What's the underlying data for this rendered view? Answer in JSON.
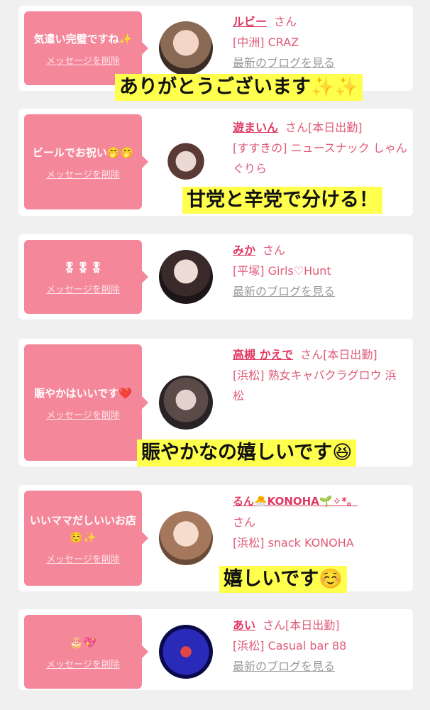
{
  "delete_label": "メッセージを削除",
  "san": "さん",
  "blog_link": "最新のブログを見る",
  "cards": [
    {
      "message": "気遣い完璧ですね✨",
      "name": "ルビー",
      "status": "",
      "shop": "[中洲] CRAZ",
      "blog": "最新のブログを見る",
      "caption": "ありがとうございます✨✨"
    },
    {
      "message": "ビールでお祝い🤭🤭",
      "name": "遊まいん",
      "status": "[本日出勤]",
      "shop": "[すすきの] ニュースナック しゃんぐりら",
      "caption": "甘党と辛党で分ける！"
    },
    {
      "message": "🎖🎖🎖",
      "name": "みか",
      "status": "",
      "shop": "[平塚] Girls♡Hunt",
      "blog": "最新のブログを見る"
    },
    {
      "message": "賑やかはいいです❤️",
      "name": "高槻 かえで",
      "status": "[本日出勤]",
      "shop": "[浜松] 熟女キャバクラグロウ 浜松",
      "caption": "賑やかなの嬉しいです😆"
    },
    {
      "message": "いいママだしいいお店☺️✨",
      "name": "るん🐣KONOHA🌱✧*。",
      "status": "",
      "shop": "[浜松] snack KONOHA",
      "caption": "嬉しいです☺️"
    },
    {
      "message": "🎂💖",
      "name": "あい",
      "status": "[本日出勤]",
      "shop": "[浜松] Casual bar 88",
      "blog": "最新のブログを見る"
    }
  ],
  "colors": {
    "bubble": "#f4879a",
    "name": "#e03a62",
    "caption_bg": "#ffff4d"
  }
}
